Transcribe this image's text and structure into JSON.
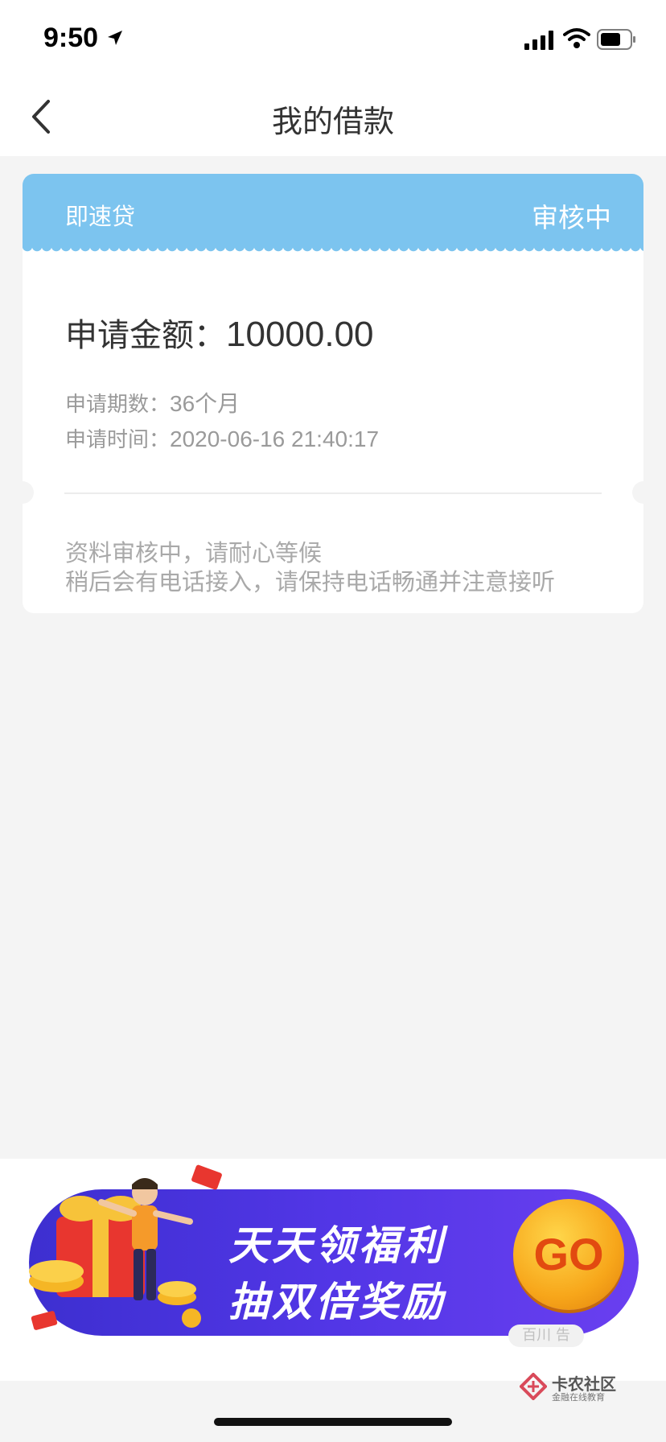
{
  "status_bar": {
    "time": "9:50"
  },
  "nav": {
    "title": "我的借款"
  },
  "loan_card": {
    "product_name": "即速贷",
    "status": "审核中",
    "amount_label": "申请金额：",
    "amount_value": "10000.00",
    "term_label": "申请期数：",
    "term_value": "36个月",
    "time_label": "申请时间：",
    "time_value": "2020-06-16 21:40:17",
    "note_line1": "资料审核中，请耐心等候",
    "note_line2": "稍后会有电话接入，请保持电话畅通并注意接听"
  },
  "banner": {
    "line1": "天天领福利",
    "line2": "抽双倍奖励",
    "go_label": "GO",
    "ad_tag": "百川 告"
  },
  "watermark": {
    "name": "卡农社区",
    "sub": "金融在线教育"
  },
  "colors": {
    "header_blue": "#7cc4ef",
    "banner_purple": "#5236e6",
    "go_orange": "#f7a61a",
    "background": "#f4f4f4"
  }
}
